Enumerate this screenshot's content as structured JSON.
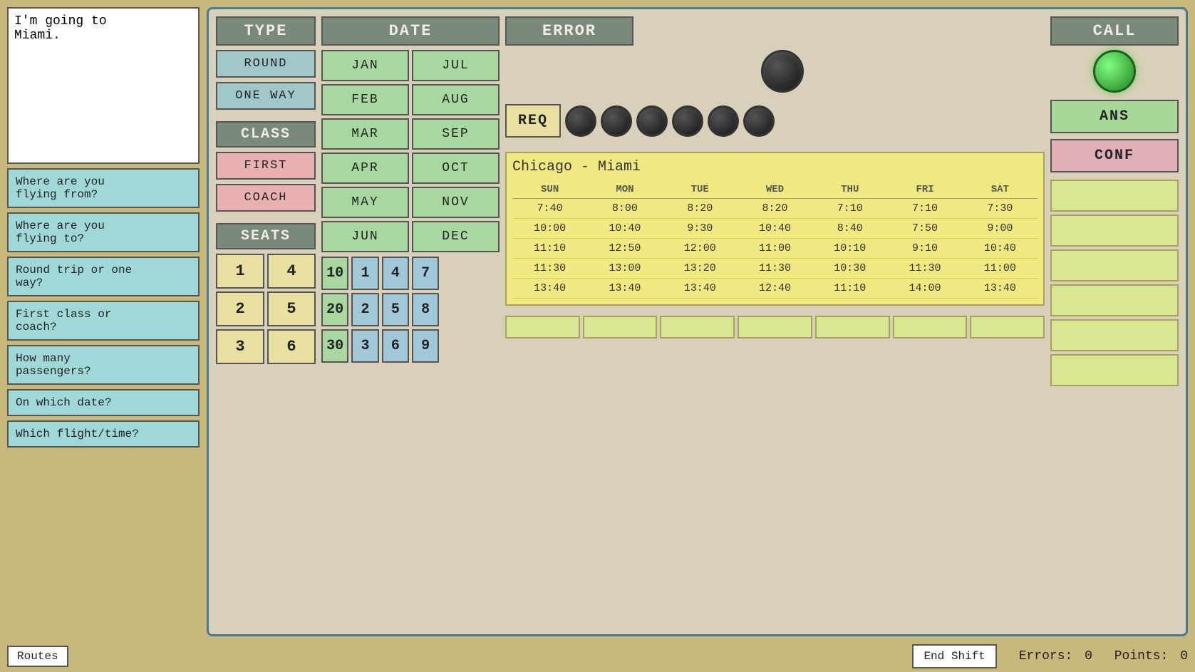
{
  "chat": {
    "text": "I'm going to\nMiami."
  },
  "questions": [
    "Where are you\nflying from?",
    "Where are you\nflying to?",
    "Round trip or one\nway?",
    "First class or\ncoach?",
    "How many\npassengers?",
    "On which date?",
    "Which flight/time?"
  ],
  "type": {
    "header": "TYPE",
    "round": "ROUND",
    "oneWay": "ONE WAY"
  },
  "class": {
    "header": "CLASS",
    "first": "FIRST",
    "coach": "COACH"
  },
  "seats": {
    "header": "SEATS",
    "values": [
      "1",
      "4",
      "2",
      "5",
      "3",
      "6"
    ]
  },
  "date": {
    "header": "DATE",
    "months": [
      "JAN",
      "JUL",
      "FEB",
      "AUG",
      "MAR",
      "SEP",
      "APR",
      "OCT",
      "MAY",
      "NOV",
      "JUN",
      "DEC"
    ],
    "tens": [
      "10",
      "20",
      "30"
    ],
    "ones": [
      "1",
      "2",
      "3",
      "4",
      "5",
      "6",
      "7",
      "8",
      "9"
    ]
  },
  "error": {
    "header": "ERROR"
  },
  "req": {
    "label": "REQ"
  },
  "call": {
    "header": "CALL",
    "ans": "ANS",
    "conf": "CONF"
  },
  "schedule": {
    "route": "Chicago - Miami",
    "days": [
      "SUN",
      "MON",
      "TUE",
      "WED",
      "THU",
      "FRI",
      "SAT"
    ],
    "rows": [
      [
        "7:40",
        "8:00",
        "8:20",
        "8:20",
        "7:10",
        "7:10",
        "7:30"
      ],
      [
        "10:00",
        "10:40",
        "9:30",
        "10:40",
        "8:40",
        "7:50",
        "9:00"
      ],
      [
        "11:10",
        "12:50",
        "12:00",
        "11:00",
        "10:10",
        "9:10",
        "10:40"
      ],
      [
        "11:30",
        "13:00",
        "13:20",
        "11:30",
        "10:30",
        "11:30",
        "11:00"
      ],
      [
        "13:40",
        "13:40",
        "13:40",
        "12:40",
        "11:10",
        "14:00",
        "13:40"
      ]
    ]
  },
  "status": {
    "endShift": "End Shift",
    "errorsLabel": "Errors:",
    "errorsValue": "0",
    "pointsLabel": "Points:",
    "pointsValue": "0",
    "routes": "Routes"
  }
}
